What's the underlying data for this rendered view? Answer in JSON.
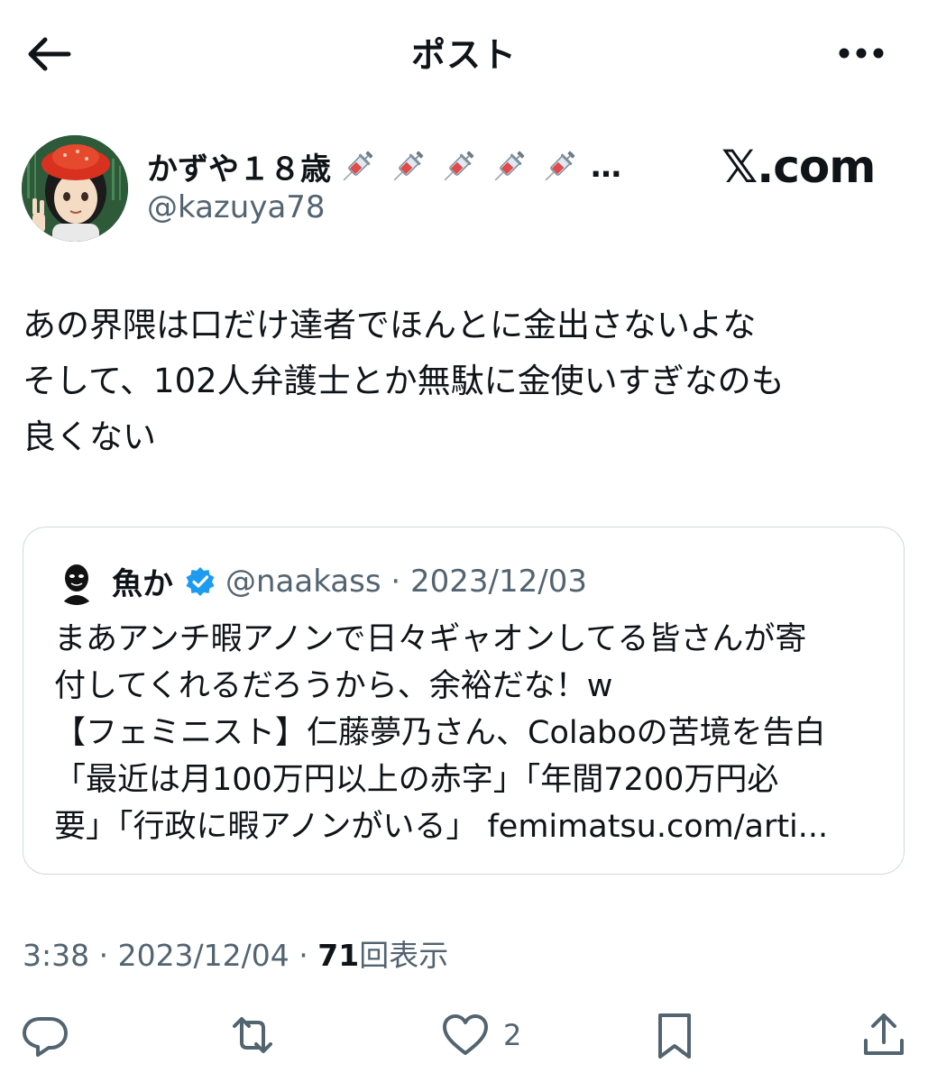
{
  "header": {
    "title": "ポスト",
    "back_icon": "arrow-left-icon",
    "more_icon": "more-dots-icon"
  },
  "author": {
    "name": "かずや１８歳",
    "name_ellipsis": "…",
    "handle": "@kazuya78",
    "emoji": "syringe-icon",
    "emoji_count": 5
  },
  "watermark": {
    "text": "𝕏.com"
  },
  "post": {
    "text": "あの界隈は口だけ達者でほんとに金出さないよな\nそして、102人弁護士とか無駄に金使いすぎなのも\n良くない"
  },
  "quote": {
    "name": "魚か",
    "verified_color": "#1d9bf0",
    "meta": "@naakass · 2023/12/03",
    "text": "まあアンチ暇アノンで日々ギャオンしてる皆さんが寄\n付してくれるだろうから、余裕だな！w\n【フェミニスト】仁藤夢乃さん、Colaboの苦境を告白\n「最近は月100万円以上の赤字」「年間7200万円必\n要」「行政に暇アノンがいる」 femimatsu.com/arti..."
  },
  "meta": {
    "time_date": "3:38 · 2023/12/04 · ",
    "views_count": "71",
    "views_label": "回表示"
  },
  "actions": {
    "reply_icon": "reply-icon",
    "retweet_icon": "retweet-icon",
    "like_icon": "heart-icon",
    "like_count": "2",
    "bookmark_icon": "bookmark-icon",
    "share_icon": "share-icon"
  },
  "colors": {
    "text": "#0f1419",
    "secondary": "#536471",
    "border": "#cfd9de",
    "accent": "#1d9bf0"
  }
}
